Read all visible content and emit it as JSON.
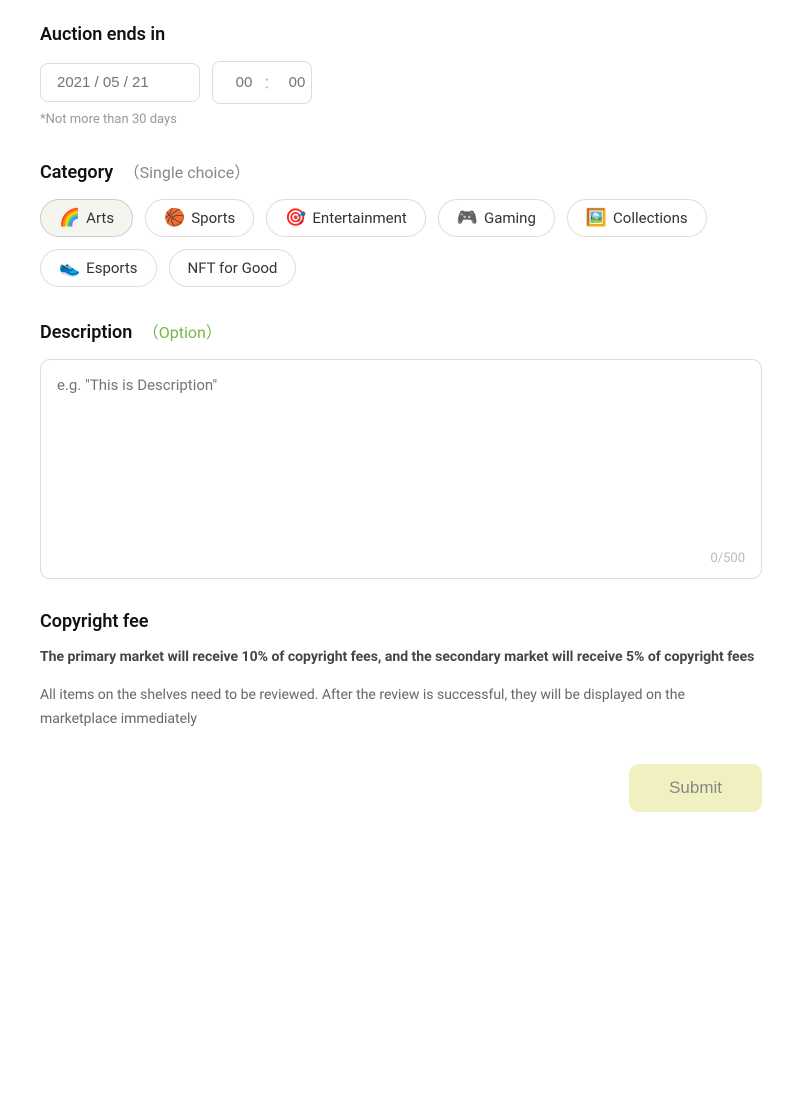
{
  "auction": {
    "title": "Auction ends in",
    "date_placeholder": "2021 / 05 / 21",
    "hour_placeholder": "00",
    "minute_placeholder": "00",
    "hint": "*Not more than 30 days"
  },
  "category": {
    "title": "Category",
    "subtitle": "（Single choice）",
    "tags": [
      {
        "id": "arts",
        "emoji": "🌈",
        "label": "Arts",
        "selected": true
      },
      {
        "id": "sports",
        "emoji": "🏀",
        "label": "Sports",
        "selected": false
      },
      {
        "id": "entertainment",
        "emoji": "🎯",
        "label": "Entertainment",
        "selected": false
      },
      {
        "id": "gaming",
        "emoji": "🎮",
        "label": "Gaming",
        "selected": false
      },
      {
        "id": "collections",
        "emoji": "🖼️",
        "label": "Collections",
        "selected": false
      },
      {
        "id": "esports",
        "emoji": "👟",
        "label": "Esports",
        "selected": false
      },
      {
        "id": "nft-for-good",
        "emoji": "",
        "label": "NFT for Good",
        "selected": false
      }
    ]
  },
  "description": {
    "title": "Description",
    "subtitle": "（Option）",
    "placeholder": "e.g. \"This is Description\"",
    "char_count": "0/500"
  },
  "copyright": {
    "title": "Copyright fee",
    "bold_text": "The primary market will receive 10% of copyright fees, and the secondary market will receive 5% of copyright fees",
    "normal_text": "All items on the shelves need to be reviewed. After the review is successful, they will be displayed on the marketplace immediately"
  },
  "submit": {
    "label": "Submit"
  }
}
